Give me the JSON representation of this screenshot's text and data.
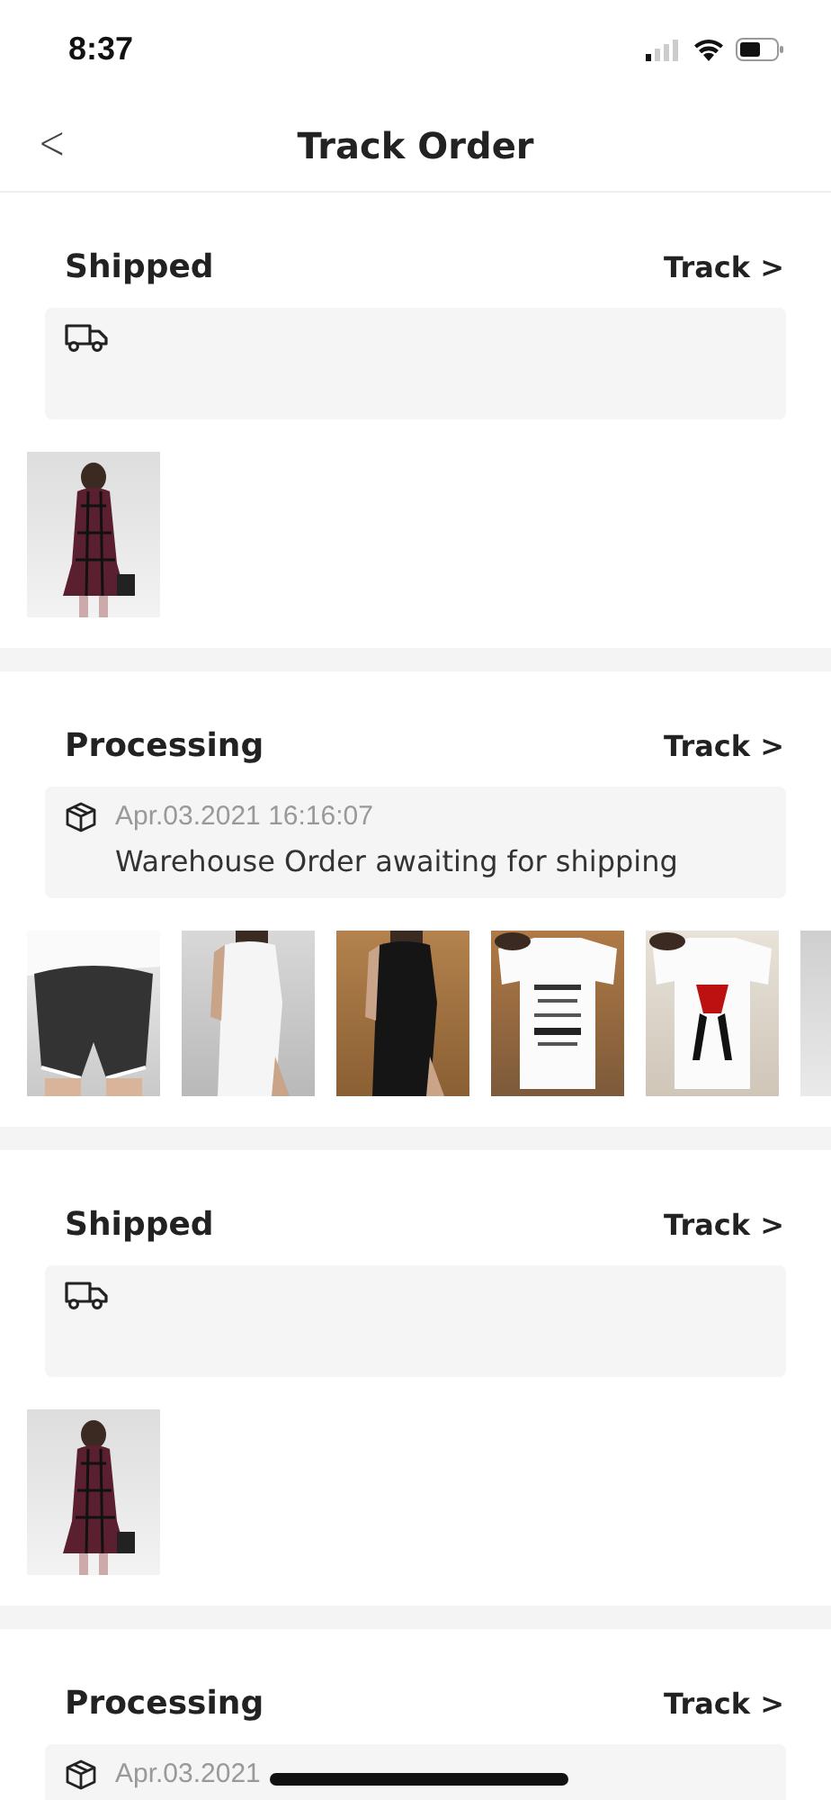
{
  "status_bar": {
    "time": "8:37"
  },
  "header": {
    "back": "<",
    "title": "Track Order"
  },
  "orders": [
    {
      "status": "Shipped",
      "track": "Track >",
      "event": {
        "kind": "truck"
      }
    },
    {
      "status": "Processing",
      "track": "Track >",
      "event": {
        "kind": "box",
        "date": "Apr.03.2021 16:16:07",
        "message": "Warehouse Order awaiting for shipping"
      }
    },
    {
      "status": "Shipped",
      "track": "Track >",
      "event": {
        "kind": "truck"
      }
    },
    {
      "status": "Processing",
      "track": "Track >",
      "event": {
        "kind": "box",
        "date": "Apr.03.2021"
      }
    }
  ]
}
